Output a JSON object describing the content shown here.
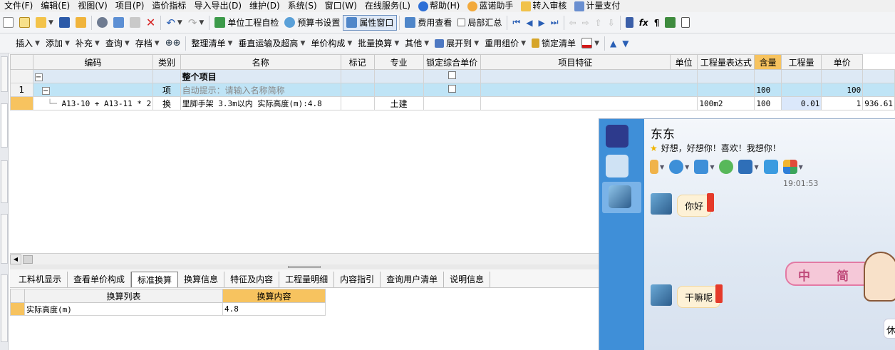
{
  "menubar": {
    "items": [
      "文件(F)",
      "编辑(E)",
      "视图(V)",
      "项目(P)",
      "造价指标",
      "导入导出(D)",
      "维护(D)",
      "系统(S)",
      "窗口(W)",
      "在线服务(L)",
      "帮助(H)",
      "蓝诺助手",
      "转入审核",
      "计量支付"
    ]
  },
  "toolbar1": {
    "self_check": "单位工程自检",
    "budget_settings": "预算书设置",
    "property_window": "属性窗口",
    "fee_view": "费用查看",
    "local_summary": "局部汇总"
  },
  "toolbar2": {
    "insert": "插入",
    "add": "添加",
    "supplement": "补充",
    "query": "查询",
    "archive": "存档",
    "tidy_list": "整理清单",
    "vertical_transport": "垂直运输及超高",
    "unit_composition": "单价构成",
    "batch_convert": "批量换算",
    "other": "其他",
    "expand_to": "展开到",
    "reuse_group_price": "重用组价",
    "lock_list": "锁定清单"
  },
  "grid": {
    "headers": [
      "编码",
      "类别",
      "名称",
      "标记",
      "专业",
      "锁定综合单价",
      "项目特征",
      "单位",
      "工程量表达式",
      "含量",
      "工程量",
      "单价"
    ],
    "rows": [
      {
        "num": "",
        "code": "",
        "type": "",
        "name": "整个项目",
        "mark": "",
        "major": "",
        "feature": "",
        "unit": "",
        "expr": "",
        "content": "",
        "qty": "",
        "price": ""
      },
      {
        "num": "1",
        "code": "",
        "type": "项",
        "name": "自动提示：请输入名称简称",
        "mark": "",
        "major": "",
        "feature": "",
        "unit": "",
        "expr": "100",
        "content": "",
        "qty": "100",
        "price": ""
      },
      {
        "num": "",
        "code": "A13-10 + A13-11 * 2",
        "type": "换",
        "name": "里脚手架 3.3m以内 实际高度(m):4.8",
        "mark": "",
        "major": "土建",
        "feature": "",
        "unit": "100m2",
        "expr": "100",
        "content": "0.01",
        "qty": "1",
        "price": "936.61"
      }
    ]
  },
  "bottom_tabs": [
    "工料机显示",
    "查看单价构成",
    "标准换算",
    "换算信息",
    "特征及内容",
    "工程量明细",
    "内容指引",
    "查询用户清单",
    "说明信息"
  ],
  "conversion": {
    "headers": [
      "换算列表",
      "换算内容"
    ],
    "rows": [
      {
        "name": "实际高度(m)",
        "value": "4.8"
      }
    ]
  },
  "chat": {
    "contact_name": "东东",
    "signature": "好想，好想你！喜欢！我想你！",
    "time": "19:01:53",
    "messages": [
      "你好",
      "干嘛呢"
    ],
    "deco_chars": [
      "中",
      "简"
    ],
    "partial_text": "休"
  }
}
